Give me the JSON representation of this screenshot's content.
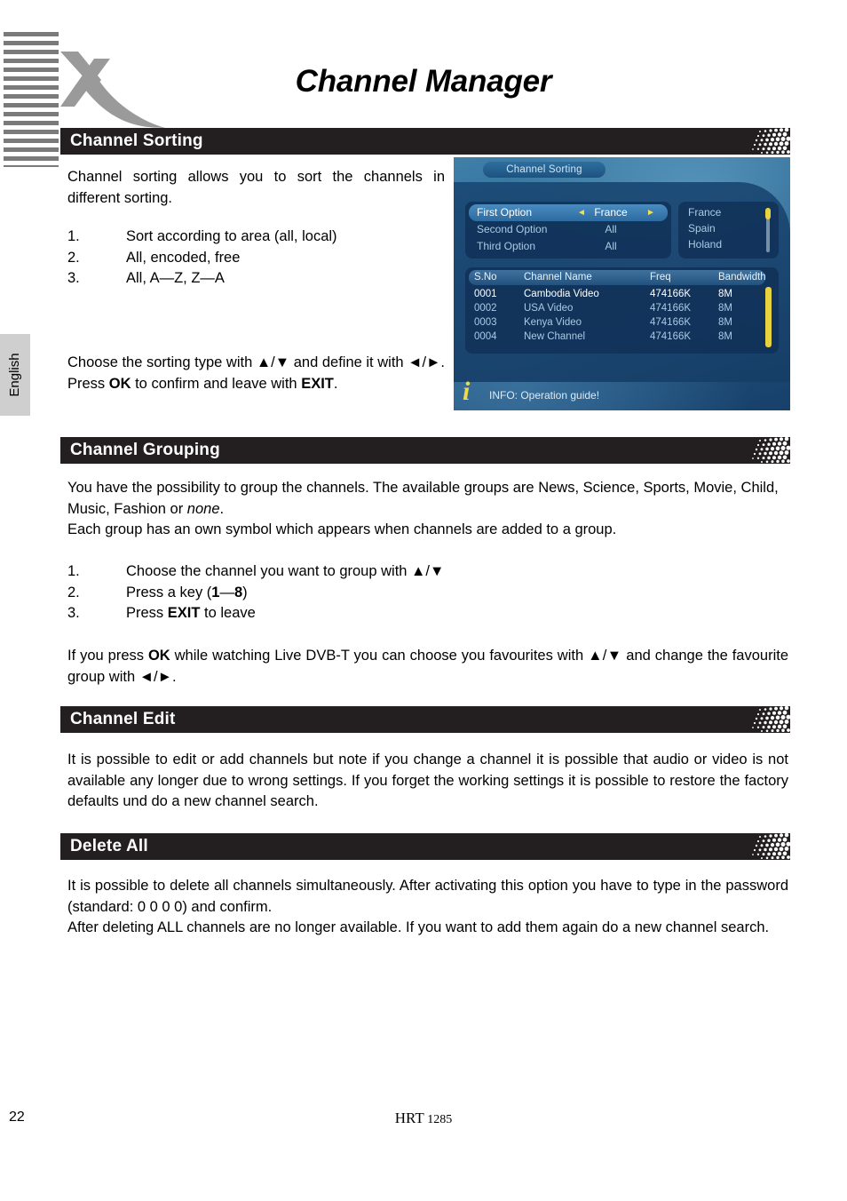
{
  "page": {
    "title": "Channel Manager",
    "language_tab": "English",
    "page_number": "22",
    "footer_model": "HRT",
    "footer_model_number": "1285",
    "brand_logo": "xoro-x-logo"
  },
  "sections": [
    {
      "id": "channel-sorting",
      "heading": "Channel Sorting",
      "intro": "Channel sorting allows you to sort the channels in different sorting.",
      "list": [
        {
          "num": "1.",
          "text": "Sort according to area (all, local)"
        },
        {
          "num": "2.",
          "text": "All, encoded, free"
        },
        {
          "num": "3.",
          "text": "All, A—Z, Z—A"
        }
      ],
      "outro_html": "Choose the sorting type with ▲/▼ and define it with ◄/►. Press <b>OK</b> to confirm and leave with <b>EXIT</b>."
    },
    {
      "id": "channel-grouping",
      "heading": "Channel Grouping",
      "intro_html": "You have the possibility to group the channels. The available groups are News, Science, Sports, Movie, Child, Music, Fashion or <i>none</i>.<br>Each group has an own symbol which appears when channels are added to a group.",
      "list": [
        {
          "num": "1.",
          "html": "Choose the channel you want to group with ▲/▼"
        },
        {
          "num": "2.",
          "html": "Press a key (<b>1</b>—<b>8</b>)"
        },
        {
          "num": "3.",
          "html": "Press <b>EXIT</b> to leave"
        }
      ],
      "outro_html": "If you press <b>OK</b> while watching Live DVB-T you can choose you favourites with ▲/▼ and change the favourite group with ◄/►."
    },
    {
      "id": "channel-edit",
      "heading": "Channel Edit",
      "body": "It is possible to edit or add channels but note if you change a channel it is possible that audio or video is not available any longer due to wrong settings. If you forget the working settings it is possible to restore the factory defaults und do a new channel search."
    },
    {
      "id": "delete-all",
      "heading": "Delete All",
      "body": "It is possible to delete all channels simultaneously. After activating this option you have to type in the password (standard: 0 0 0 0)  and confirm.\nAfter deleting ALL channels are no longer available. If you want to add them again do a new channel search."
    }
  ],
  "tv_screenshot": {
    "window_title": "Channel Sorting",
    "options": [
      {
        "label": "First Option",
        "value": "France",
        "selected": true,
        "arrow_left": "◄",
        "arrow_right": "►"
      },
      {
        "label": "Second Option",
        "value": "All",
        "selected": false
      },
      {
        "label": "Third Option",
        "value": "All",
        "selected": false
      }
    ],
    "country_list": [
      "France",
      "Spain",
      "Holand"
    ],
    "table": {
      "headers": [
        "S.No",
        "Channel Name",
        "Freq",
        "Bandwidth"
      ],
      "rows": [
        {
          "sno": "0001",
          "name": "Cambodia Video",
          "freq": "474166K",
          "bw": "8M"
        },
        {
          "sno": "0002",
          "name": "USA Video",
          "freq": "474166K",
          "bw": "8M"
        },
        {
          "sno": "0003",
          "name": "Kenya Video",
          "freq": "474166K",
          "bw": "8M"
        },
        {
          "sno": "0004",
          "name": "New Channel",
          "freq": "474166K",
          "bw": "8M"
        }
      ]
    },
    "info_bar": "INFO: Operation guide!",
    "info_icon": "info-i-icon",
    "colors": {
      "bg_blue": "#2e6b96",
      "panel_blue": "#1a4874",
      "highlight_blue": "#4a8cc0",
      "accent_yellow": "#e9d23f",
      "text_light": "#a9cbe4"
    }
  },
  "theme": {
    "bar_black": "#231f20",
    "stripe_gray": "#7a7a7a",
    "tab_gray": "#cfcfcf"
  }
}
